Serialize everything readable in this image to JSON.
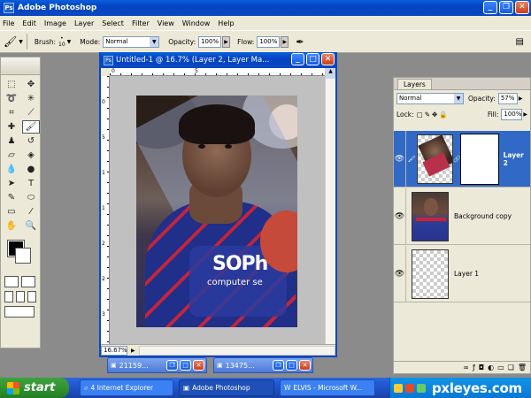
{
  "app": {
    "title": "Adobe Photoshop",
    "logo_text": "Ps"
  },
  "menu": [
    "File",
    "Edit",
    "Image",
    "Layer",
    "Select",
    "Filter",
    "View",
    "Window",
    "Help"
  ],
  "options": {
    "brush_label": "Brush:",
    "brush_size": "10",
    "mode_label": "Mode:",
    "mode_value": "Normal",
    "opacity_label": "Opacity:",
    "opacity_value": "100%",
    "flow_label": "Flow:",
    "flow_value": "100%"
  },
  "document": {
    "title": "Untitled-1 @ 16.7% (Layer 2, Layer Ma...",
    "zoom": "16.67%",
    "ruler_top": [
      "0",
      "5"
    ],
    "ruler_left": [
      "0",
      "5",
      "1",
      "1",
      "2",
      "2",
      "3"
    ]
  },
  "minimized": [
    {
      "title": "21159..."
    },
    {
      "title": "13475..."
    }
  ],
  "layers_panel": {
    "tab": "Layers",
    "blend_mode": "Normal",
    "opacity_label": "Opacity:",
    "opacity_value": "57%",
    "lock_label": "Lock:",
    "fill_label": "Fill:",
    "fill_value": "100%",
    "layers": [
      {
        "name": "Layer 2",
        "selected": true
      },
      {
        "name": "Background copy",
        "selected": false
      },
      {
        "name": "Layer 1",
        "selected": false
      }
    ]
  },
  "taskbar": {
    "start": "start",
    "buttons": [
      {
        "label": "4 Internet Explorer",
        "active": false
      },
      {
        "label": "Adobe Photoshop",
        "active": true
      },
      {
        "label": "ELVIS - Microsoft W...",
        "active": false
      }
    ]
  },
  "watermark": "pxleyes.com",
  "colors": {
    "titlebar": "#0a48c0",
    "selected_layer": "#3169c6",
    "start_green": "#2f8f2f"
  }
}
